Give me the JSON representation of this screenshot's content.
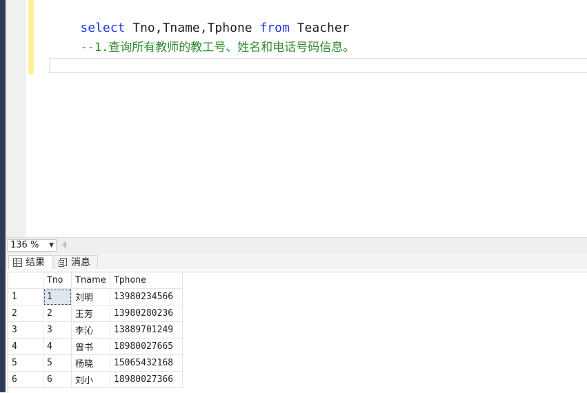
{
  "editor": {
    "lines": [
      {
        "parts": [
          {
            "text": "select",
            "kind": "kw"
          },
          {
            "text": " Tno,Tname,Tphone ",
            "kind": "txt"
          },
          {
            "text": "from",
            "kind": "kw"
          },
          {
            "text": " Teacher",
            "kind": "txt"
          }
        ]
      },
      {
        "parts": [
          {
            "text": "--1.查询所有教师的教工号、姓名和电话号码信息。",
            "kind": "cmt"
          }
        ]
      }
    ]
  },
  "statusbar": {
    "zoom": "136 %"
  },
  "results": {
    "tabs": [
      {
        "label": "结果",
        "icon": "grid-icon"
      },
      {
        "label": "消息",
        "icon": "messages-icon"
      }
    ],
    "columns": [
      "Tno",
      "Tname",
      "Tphone"
    ],
    "rows": [
      {
        "num": "1",
        "cells": [
          "1",
          "刘明",
          "13980234566"
        ]
      },
      {
        "num": "2",
        "cells": [
          "2",
          "王芳",
          "13980280236"
        ]
      },
      {
        "num": "3",
        "cells": [
          "3",
          "李沁",
          "13889701249"
        ]
      },
      {
        "num": "4",
        "cells": [
          "4",
          "曾书",
          "18980027665"
        ]
      },
      {
        "num": "5",
        "cells": [
          "5",
          "杨晓",
          "15065432168"
        ]
      },
      {
        "num": "6",
        "cells": [
          "6",
          "刘小",
          "18980027366"
        ]
      }
    ]
  },
  "colors": {
    "keyword": "#1d36e8",
    "comment": "#2f8a2f",
    "change_bar": "#fff29a",
    "selected_cell": "#dfe6ef"
  }
}
